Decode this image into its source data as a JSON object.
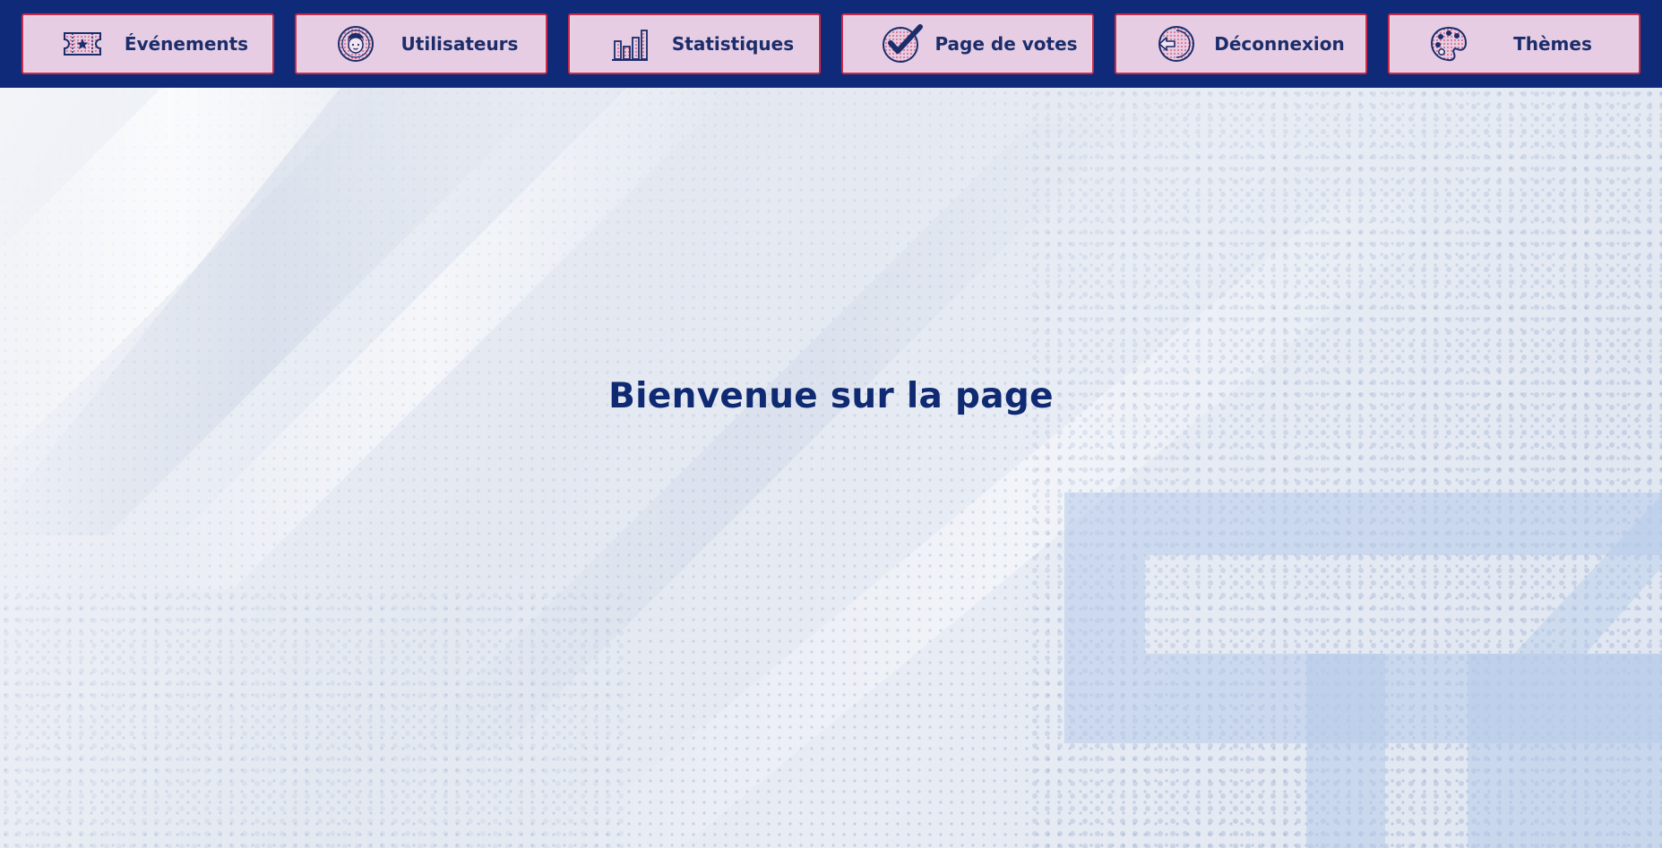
{
  "nav": {
    "items": [
      {
        "label": "Événements",
        "icon": "ticket-icon"
      },
      {
        "label": "Utilisateurs",
        "icon": "user-avatar-icon"
      },
      {
        "label": "Statistiques",
        "icon": "bar-chart-icon"
      },
      {
        "label": "Page de votes",
        "icon": "checkmark-icon"
      },
      {
        "label": "Déconnexion",
        "icon": "logout-arrow-icon"
      },
      {
        "label": "Thèmes",
        "icon": "palette-icon"
      }
    ]
  },
  "main": {
    "welcome_text": "Bienvenue sur la page"
  },
  "colors": {
    "topbar": "#0e2a78",
    "button_bg": "#e6cde3",
    "button_border": "#cc2c4a",
    "text": "#1b2d6b"
  }
}
